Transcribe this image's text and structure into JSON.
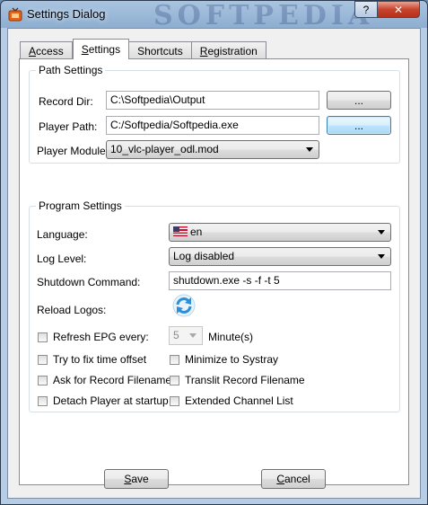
{
  "window": {
    "title": "Settings Dialog",
    "watermark": "SOFTPEDIA",
    "help_label": "?",
    "close_label": "✕"
  },
  "tabs": [
    {
      "label": "Access",
      "accel": "A",
      "rest": "ccess",
      "active": false
    },
    {
      "label": "Settings",
      "accel": "S",
      "rest": "ettings",
      "active": true
    },
    {
      "label": "Shortcuts",
      "accel": "",
      "rest": "Shortcuts",
      "active": false
    },
    {
      "label": "Registration",
      "accel": "R",
      "rest": "egistration",
      "active": false
    }
  ],
  "path_settings": {
    "title": "Path Settings",
    "record_dir_label": "Record Dir:",
    "record_dir_value": "C:\\Softpedia\\Output",
    "record_dir_browse": "...",
    "player_path_label": "Player Path:",
    "player_path_value": "C:/Softpedia/Softpedia.exe",
    "player_path_browse": "...",
    "player_module_label": "Player Module:",
    "player_module_value": "10_vlc-player_odl.mod"
  },
  "program_settings": {
    "title": "Program Settings",
    "language_label": "Language:",
    "language_value": "en",
    "log_level_label": "Log Level:",
    "log_level_value": "Log disabled",
    "shutdown_label": "Shutdown Command:",
    "shutdown_value": "shutdown.exe -s -f -t 5",
    "reload_logos_label": "Reload Logos:",
    "refresh_epg_label": "Refresh EPG every:",
    "refresh_epg_value": "5",
    "minutes_label": "Minute(s)",
    "fix_time_label": "Try to fix time offset",
    "minimize_label": "Minimize to Systray",
    "ask_record_label": "Ask for Record Filename",
    "translit_label": "Translit Record Filename",
    "detach_label": "Detach Player at startup",
    "extended_label": "Extended Channel List"
  },
  "buttons": {
    "save_accel": "S",
    "save_rest": "ave",
    "cancel_accel": "C",
    "cancel_rest": "ancel"
  },
  "colors": {
    "accent": "#3c7fb1",
    "close_red": "#c7432d",
    "refresh_blue": "#2f8fd6"
  }
}
